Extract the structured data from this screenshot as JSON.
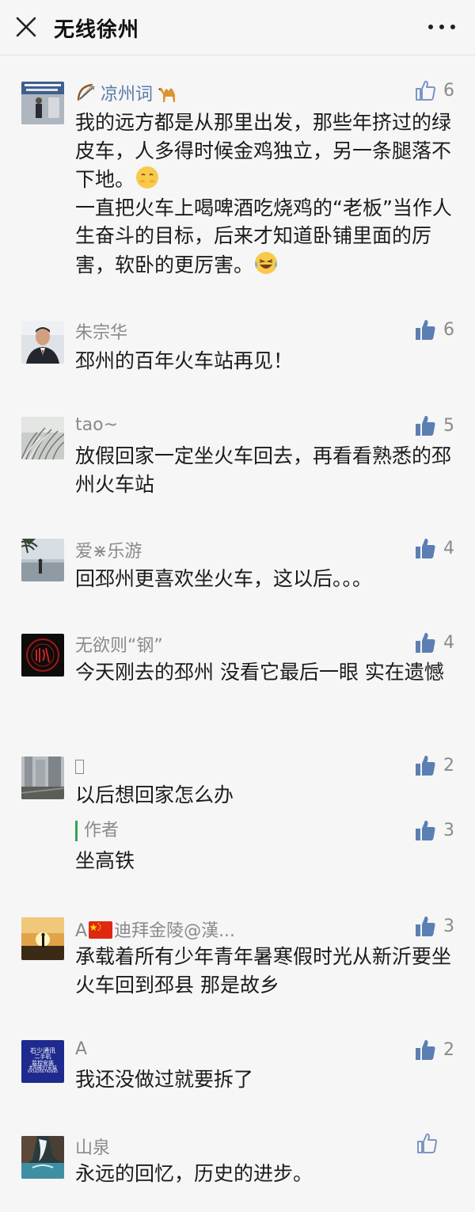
{
  "header": {
    "title": "无线徐州"
  },
  "colors": {
    "author_tag": "#2fa84f",
    "like_active": "#5b7fb3",
    "like_inactive": "#7b96c4"
  },
  "comments": [
    {
      "name": "凉州词",
      "name_icons": [
        "bow-and-arrow-icon",
        "camel-icon"
      ],
      "likes": "6",
      "liked": false,
      "lines": [
        "我的远方都是从那里出发，那些年挤过的绿皮车，人多得时候金鸡独立，另一条腿落不下地。",
        "一直把火车上喝啤酒吃烧鸡的“老板”当作人生奋斗的目标，后来才知道卧铺里面的厉害，软卧的更厉害。"
      ],
      "emojis": [
        "covering-mouth-face-icon",
        "laughing-tears-face-icon"
      ]
    },
    {
      "name": "朱宗华",
      "likes": "6",
      "liked": true,
      "lines": [
        "邳州的百年火车站再见！"
      ]
    },
    {
      "name": "tao~",
      "likes": "5",
      "liked": true,
      "lines": [
        "放假回家一定坐火车回去，再看看熟悉的邳州火车站"
      ]
    },
    {
      "name": "爱⋇乐游",
      "likes": "4",
      "liked": true,
      "lines": [
        "回邳州更喜欢坐火车，这以后。。。"
      ]
    },
    {
      "name": "无欲则“钢”",
      "likes": "4",
      "liked": true,
      "lines": [
        "今天刚去的邳州 没看它最后一眼 实在遗憾"
      ]
    },
    {
      "name": "",
      "likes": "2",
      "liked": true,
      "lines": [
        "以后想回家怎么办"
      ],
      "reply": {
        "tag": "作者",
        "likes": "3",
        "text": "坐高铁"
      }
    },
    {
      "name_prefix": "A",
      "name": "迪拜金陵@漢...",
      "likes": "3",
      "liked": true,
      "lines": [
        "承载着所有少年青年暑寒假时光从新沂要坐火车回到邳县 那是故乡"
      ]
    },
    {
      "name": "A",
      "likes": "2",
      "liked": true,
      "lines": [
        "我还没做过就要拆了"
      ],
      "avatar_text": {
        "line1": "石少通讯",
        "line2": "二手机",
        "line3": "监控安装",
        "line4": "太阳能灯安装",
        "line5": "VX18260792685"
      }
    },
    {
      "name": "山泉",
      "likes": "",
      "liked": false,
      "lines": [
        "永远的回忆，历史的进步。"
      ]
    }
  ]
}
